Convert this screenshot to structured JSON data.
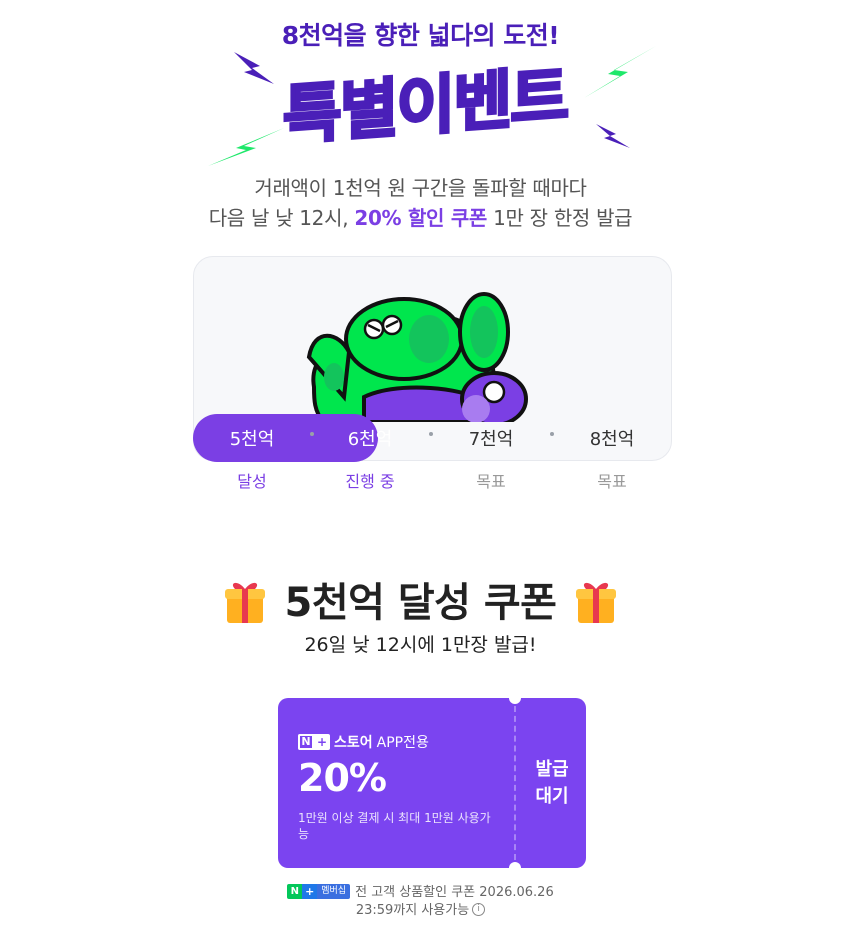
{
  "header": {
    "headline": "8천억을 향한 넓다의 도전!",
    "title": "특별이벤트",
    "desc_line1": "거래액이 1천억 원 구간을 돌파할 때마다",
    "desc_line2_pre": "다음 날 낮 12시, ",
    "desc_line2_highlight": "20% 할인 쿠폰",
    "desc_line2_post": " 1만 장 한정 발급"
  },
  "progress": {
    "steps": [
      {
        "label": "5천억",
        "status": "달성"
      },
      {
        "label": "6천억",
        "status": "진행 중"
      },
      {
        "label": "7천억",
        "status": "목표"
      },
      {
        "label": "8천억",
        "status": "목표"
      }
    ],
    "achieved_steps": 1
  },
  "coupon_section": {
    "title": "5천억 달성 쿠폰",
    "subtitle": "26일 낮 12시에 1만장 발급!"
  },
  "coupon": {
    "store": "스토어",
    "app_only": "APP전용",
    "discount": "20%",
    "condition": "1만원 이상 결제 시 최대 1만원 사용가능",
    "issue_line1": "발급",
    "issue_line2": "대기",
    "badge_n": "N",
    "badge_plus": "+"
  },
  "footer": {
    "badge_text": "멤버십",
    "line1": "전 고객 상품할인 쿠폰 2026.06.26",
    "line2": "23:59까지 사용가능",
    "info_glyph": "i"
  },
  "colors": {
    "accent": "#7b3fe4",
    "headline": "#4a1fb8",
    "bolt_green": "#1ee86a",
    "bolt_purple": "#4a1fb8",
    "mascot_green": "#00e64d"
  },
  "icons": [
    "lightning-bolt-icon",
    "gift-icon",
    "info-icon"
  ]
}
